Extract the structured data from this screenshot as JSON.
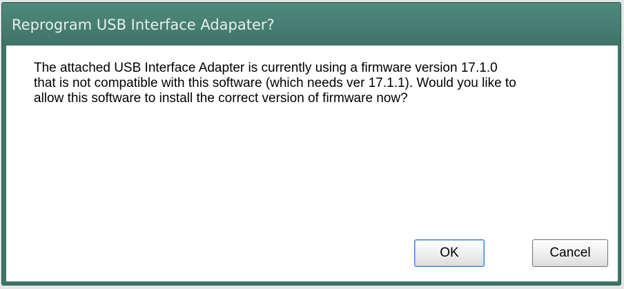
{
  "dialog": {
    "title": "Reprogram USB Interface Adapater?",
    "message": "The attached USB Interface Adapter is currently using a firmware version 17.1.0\nthat is not compatible with this software (which needs ver 17.1.1).  Would you like to\nallow this software to install the correct version of firmware now?",
    "buttons": {
      "ok_label": "OK",
      "cancel_label": "Cancel"
    }
  },
  "colors": {
    "titlebar": "#3f7468",
    "title_text": "#e7efe9",
    "content_bg": "#ffffff",
    "default_button_border": "#3a78c8"
  }
}
